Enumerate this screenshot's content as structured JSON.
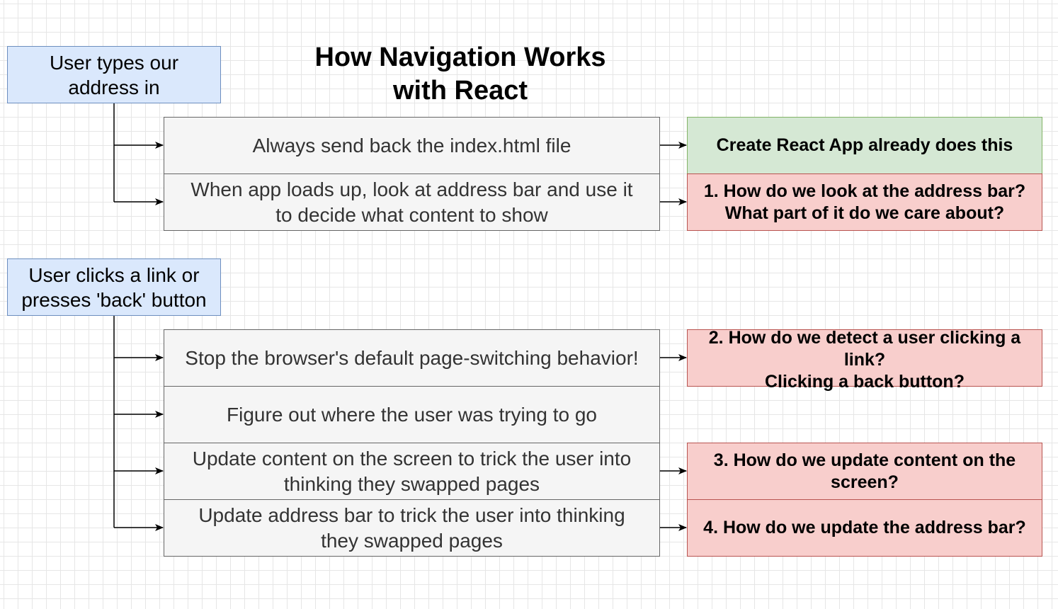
{
  "diagram": {
    "title": "How Navigation Works\nwith React",
    "triggers": [
      {
        "id": "user-types-address",
        "label": "User types our\naddress in"
      },
      {
        "id": "user-clicks-link",
        "label": "User clicks a link or\npresses 'back' button"
      }
    ],
    "steps": [
      {
        "id": "send-index",
        "label": "Always send back the index.html file"
      },
      {
        "id": "look-address-bar",
        "label": "When app loads up, look at address bar and use it\nto decide what content to show"
      },
      {
        "id": "stop-default",
        "label": "Stop the browser's default page-switching behavior!"
      },
      {
        "id": "figure-out",
        "label": "Figure out where the user was trying to go"
      },
      {
        "id": "update-content",
        "label": "Update content on the screen to trick the user into\nthinking they swapped pages"
      },
      {
        "id": "update-address",
        "label": "Update address bar to trick the user into thinking\nthey swapped pages"
      }
    ],
    "notes": [
      {
        "id": "cra-does-this",
        "label": "Create React App already does this",
        "status": "done"
      },
      {
        "id": "q1",
        "label": "1. How do we look at the address bar?\nWhat part of it do we care about?",
        "status": "question"
      },
      {
        "id": "q2",
        "label": "2. How do we detect a user clicking a\nlink?\nClicking a back button?",
        "status": "question"
      },
      {
        "id": "q3",
        "label": "3. How do we update content on the\nscreen?",
        "status": "question"
      },
      {
        "id": "q4",
        "label": "4. How do we update the address bar?",
        "status": "question"
      }
    ],
    "edges": [
      {
        "from": "user-types-address",
        "to": "send-index"
      },
      {
        "from": "user-types-address",
        "to": "look-address-bar"
      },
      {
        "from": "user-clicks-link",
        "to": "stop-default"
      },
      {
        "from": "user-clicks-link",
        "to": "figure-out"
      },
      {
        "from": "user-clicks-link",
        "to": "update-content"
      },
      {
        "from": "user-clicks-link",
        "to": "update-address"
      },
      {
        "from": "send-index",
        "to": "cra-does-this"
      },
      {
        "from": "look-address-bar",
        "to": "q1"
      },
      {
        "from": "stop-default",
        "to": "q2"
      },
      {
        "from": "update-content",
        "to": "q3"
      },
      {
        "from": "update-address",
        "to": "q4"
      }
    ],
    "colors": {
      "trigger_fill": "#dae8fc",
      "trigger_stroke": "#6c8ebf",
      "step_fill": "#f5f5f5",
      "step_stroke": "#666666",
      "done_fill": "#d5e8d4",
      "done_stroke": "#82b366",
      "question_fill": "#f8cecc",
      "question_stroke": "#b85450"
    }
  }
}
